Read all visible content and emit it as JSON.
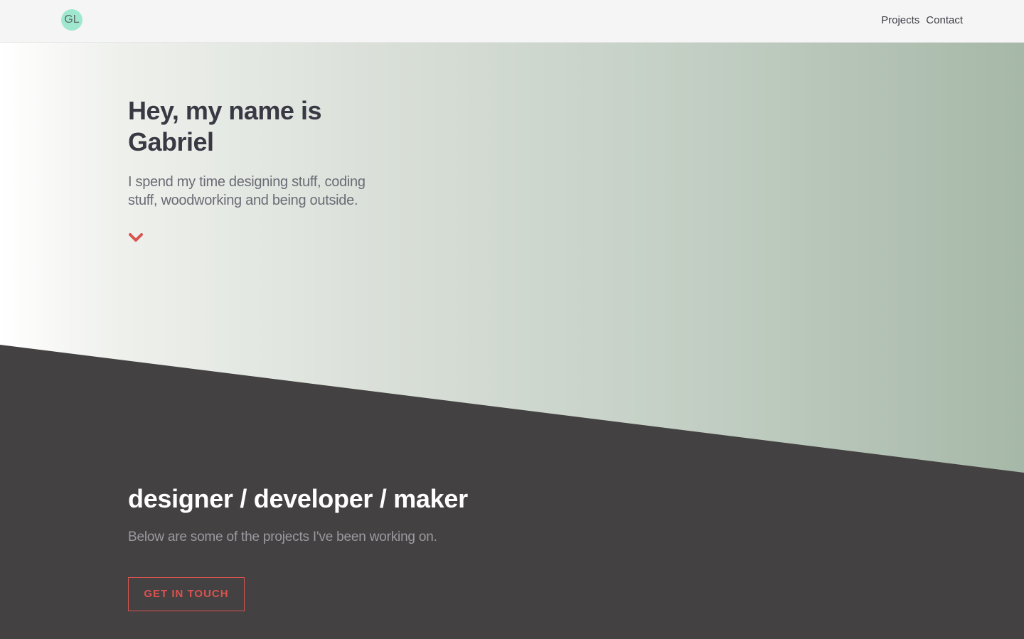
{
  "colors": {
    "accent": "#d9534f",
    "logo_bg": "#9fe8cf",
    "dark_band": "#444142",
    "hero_text": "#393944"
  },
  "header": {
    "logo_text": "GL",
    "nav": [
      {
        "label": "Projects"
      },
      {
        "label": "Contact"
      }
    ]
  },
  "hero": {
    "title": "Hey, my name is Gabriel",
    "subtitle": "I spend my time designing stuff, coding stuff, woodworking and being outside.",
    "scroll_icon": "chevron-down-icon"
  },
  "section": {
    "tagline": "designer / developer / maker",
    "intro": "Below are some of the projects I've been working on.",
    "cta_label": "GET IN TOUCH"
  }
}
